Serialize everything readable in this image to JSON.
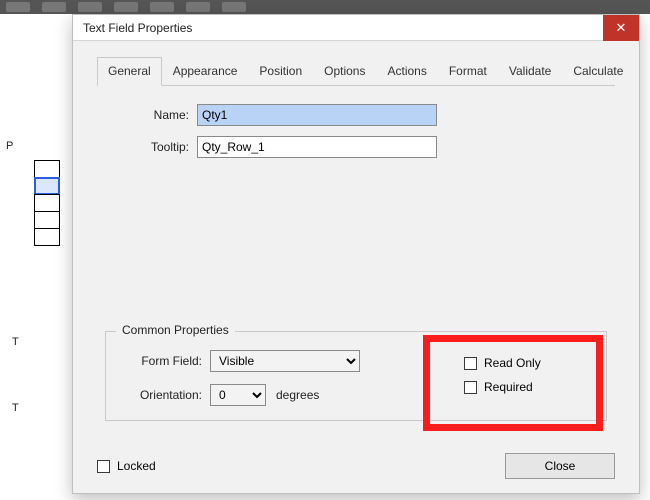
{
  "dialog": {
    "title": "Text Field Properties",
    "tabs": [
      "General",
      "Appearance",
      "Position",
      "Options",
      "Actions",
      "Format",
      "Validate",
      "Calculate"
    ],
    "active_tab": 0,
    "name_label": "Name:",
    "name_value": "Qty1",
    "tooltip_label": "Tooltip:",
    "tooltip_value": "Qty_Row_1",
    "group_title": "Common Properties",
    "form_field_label": "Form Field:",
    "form_field_value": "Visible",
    "orientation_label": "Orientation:",
    "orientation_value": "0",
    "orientation_unit": "degrees",
    "readonly_label": "Read Only",
    "required_label": "Required",
    "locked_label": "Locked",
    "close_label": "Close"
  },
  "side": {
    "p": "P",
    "t1": "T",
    "t2": "T"
  }
}
